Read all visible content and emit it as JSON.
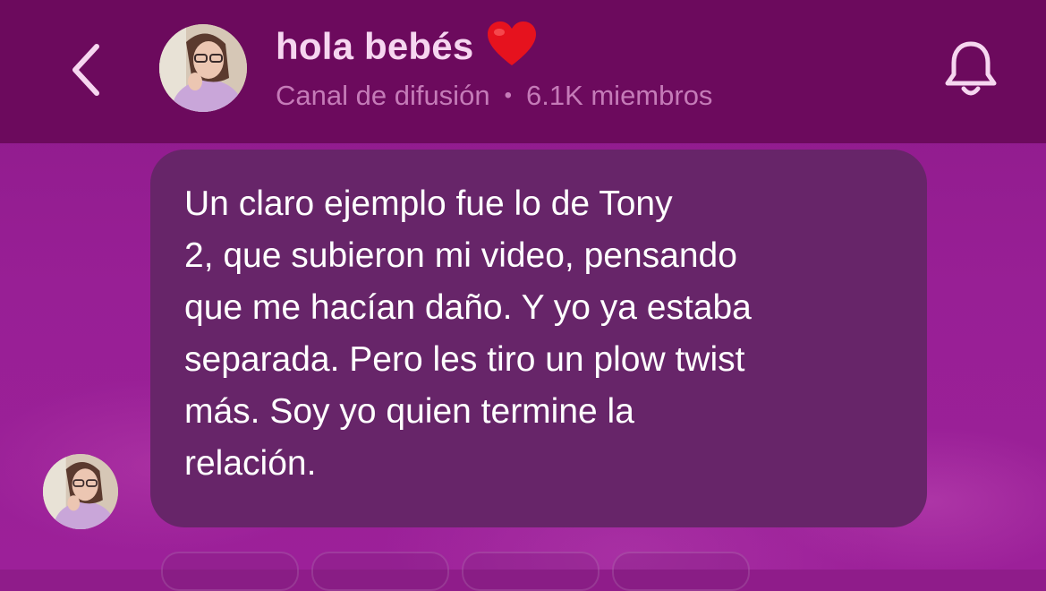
{
  "header": {
    "title": "hola bebés",
    "title_emoji": "❤️",
    "subtitle_type": "Canal de difusión",
    "subtitle_separator": "•",
    "subtitle_members": "6.1K miembros",
    "back_icon": "chevron-left-icon",
    "bell_icon": "bell-icon"
  },
  "message": {
    "lines": [
      "Un claro ejemplo fue lo de Tony",
      "2, que subieron mi video, pensando",
      "que me hacían daño. Y yo ya estaba",
      "separada. Pero les tiro un plow twist",
      "más. Soy yo quien termine la",
      "relación."
    ]
  },
  "colors": {
    "header_bg": "#6c0a5d",
    "chat_bg": "#981f95",
    "bubble_bg": "#672569",
    "title": "#f6d6f0",
    "subtitle": "#c57bb8",
    "icon": "#f6d6f0"
  }
}
